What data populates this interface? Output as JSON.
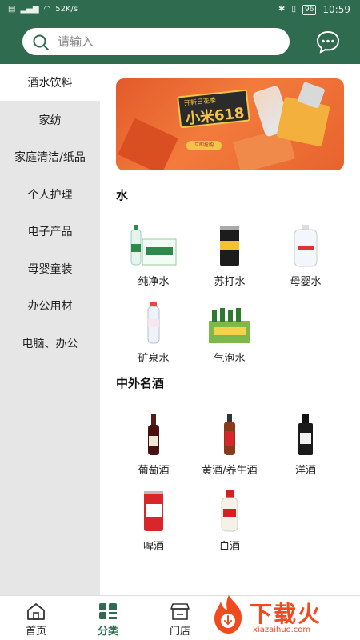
{
  "status_bar": {
    "left_icons": [
      "sim-icon",
      "signal-icon",
      "wifi-icon"
    ],
    "network_speed": "52K/s",
    "battery": "96",
    "time": "10:59"
  },
  "search": {
    "placeholder": "请输入",
    "value": ""
  },
  "header": {
    "message_icon": "chat-bubble-icon"
  },
  "sidebar": {
    "items": [
      {
        "label": "酒水饮料",
        "active": true
      },
      {
        "label": "家纺"
      },
      {
        "label": "家庭清洁/纸品"
      },
      {
        "label": "个人护理"
      },
      {
        "label": "电子产品"
      },
      {
        "label": "母婴童装"
      },
      {
        "label": "办公用材"
      },
      {
        "label": "电脑、办公"
      }
    ]
  },
  "banner": {
    "sign_top": "开新日花季",
    "sign_main": "小米618",
    "button": "立即抢购"
  },
  "sections": [
    {
      "title": "水",
      "products": [
        {
          "label": "纯净水"
        },
        {
          "label": "苏打水"
        },
        {
          "label": "母婴水"
        },
        {
          "label": "矿泉水"
        },
        {
          "label": "气泡水"
        }
      ]
    },
    {
      "title": "中外名酒",
      "products": [
        {
          "label": "葡萄酒"
        },
        {
          "label": "黄酒/养生酒"
        },
        {
          "label": "洋酒"
        },
        {
          "label": "啤酒"
        },
        {
          "label": "白酒"
        }
      ]
    }
  ],
  "tabbar": {
    "tabs": [
      {
        "label": "首页",
        "icon": "home-icon"
      },
      {
        "label": "分类",
        "icon": "category-grid-icon",
        "active": true
      },
      {
        "label": "门店",
        "icon": "store-icon"
      }
    ]
  },
  "watermark": {
    "text": "下载火",
    "sub": "xiazaihuo.com"
  },
  "colors": {
    "brand": "#2f6b4e",
    "sidebar_bg": "#e6e6e6",
    "watermark": "#f04a1e"
  }
}
